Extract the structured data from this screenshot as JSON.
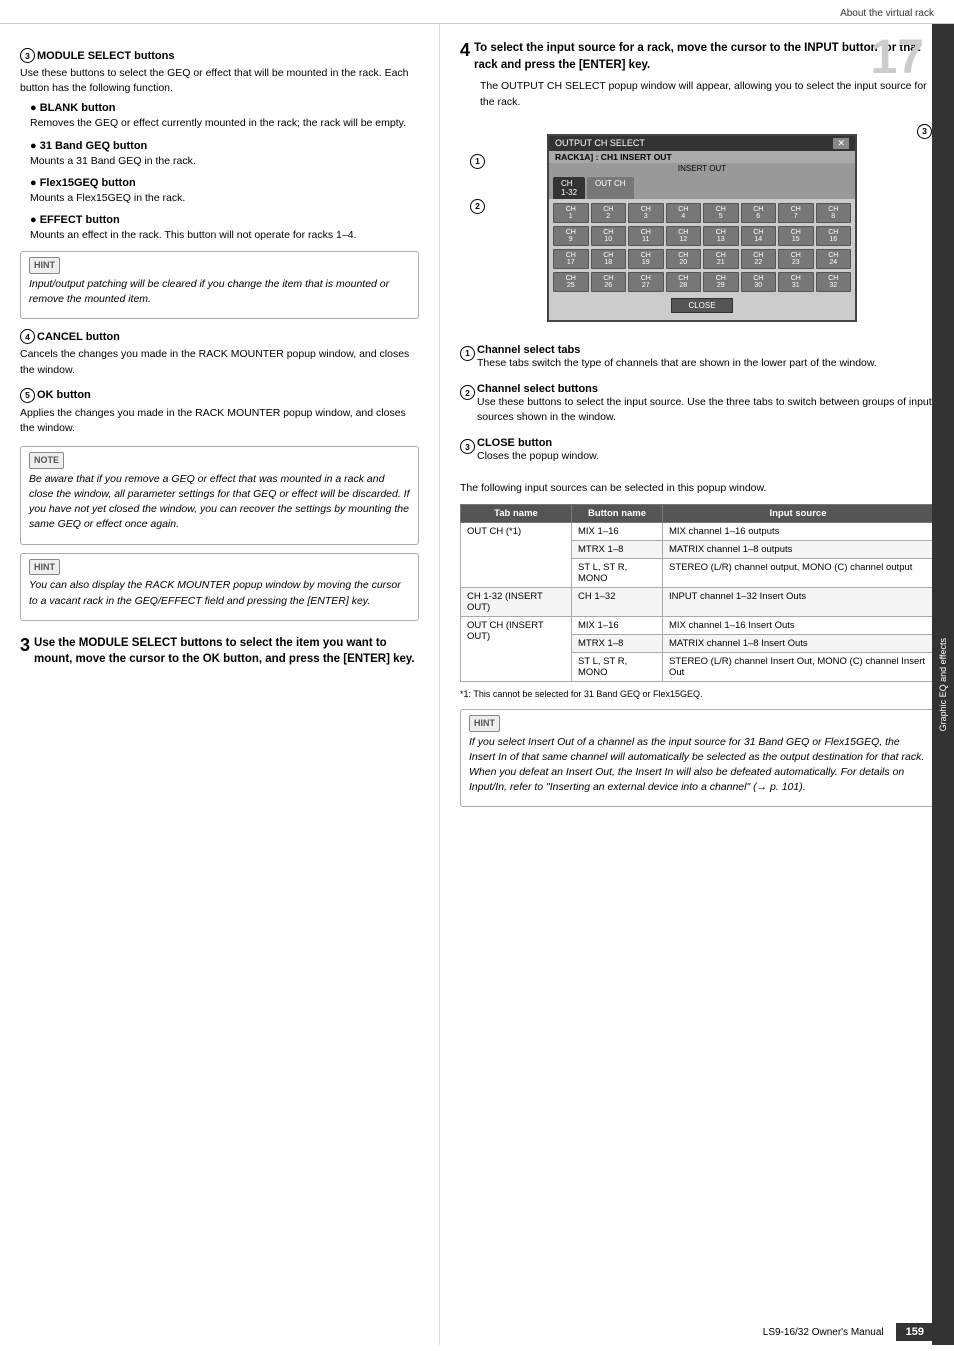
{
  "header": {
    "title": "About the virtual rack"
  },
  "footer": {
    "manual": "LS9-16/32  Owner's Manual",
    "page": "159"
  },
  "chapter": {
    "number": "17",
    "label": "Graphic EQ and effects"
  },
  "left_column": {
    "section3_circle": "3",
    "section3_title": "MODULE SELECT buttons",
    "section3_body": "Use these buttons to select the GEQ or effect that will be mounted in the rack. Each button has the following function.",
    "blank_button_title": "BLANK button",
    "blank_button_body": "Removes the GEQ or effect currently mounted in the rack; the rack will be empty.",
    "band31_button_title": "31 Band GEQ button",
    "band31_button_body": "Mounts a 31 Band GEQ in the rack.",
    "flex15_button_title": "Flex15GEQ button",
    "flex15_button_body": "Mounts a Flex15GEQ in the rack.",
    "effect_button_title": "EFFECT button",
    "effect_button_body": "Mounts an effect in the rack. This button will not operate for racks 1–4.",
    "hint1_label": "HINT",
    "hint1_text": "Input/output patching will be cleared if you change the item that is mounted or remove the mounted item.",
    "section4_circle": "4",
    "section4_title": "CANCEL button",
    "section4_body": "Cancels the changes you made in the RACK MOUNTER popup window, and closes the window.",
    "section5_circle": "5",
    "section5_title": "OK button",
    "section5_body": "Applies the changes you made in the RACK MOUNTER popup window, and closes the window.",
    "note_label": "NOTE",
    "note_text": "Be aware that if you remove a GEQ or effect that was mounted in a rack and close the window, all parameter settings for that GEQ or effect will be discarded. If you have not yet closed the window, you can recover the settings by mounting the same GEQ or effect once again.",
    "hint2_label": "HINT",
    "hint2_text": "You can also display the RACK MOUNTER popup window by moving the cursor to a vacant rack in the GEQ/EFFECT field and pressing the [ENTER] key.",
    "step3_number": "3",
    "step3_text": "Use the MODULE SELECT buttons to select the item you want to mount, move the cursor to the OK button, and press the [ENTER] key."
  },
  "right_column": {
    "step4_number": "4",
    "step4_text": "To select the input source for a rack, move the cursor to the INPUT button for that rack and press the [ENTER] key.",
    "step4_body": "The OUTPUT CH SELECT popup window will appear, allowing you to select the input source for the rack.",
    "popup": {
      "title": "OUTPUT CH SELECT",
      "subtitle": "RACK1A] : CH1  INSERT OUT",
      "subtitle2": "INSERT OUT",
      "tabs": [
        "CH 1-32",
        "OUT CH"
      ],
      "active_tab": "CH 1-32",
      "annotation1": "1",
      "annotation2": "2",
      "annotation3": "3",
      "close_label": "CLOSE",
      "rows": [
        [
          "CH 1",
          "CH 2",
          "CH 3",
          "CH 4",
          "CH 5",
          "CH 6",
          "CH 7",
          "CH 8"
        ],
        [
          "CH 9",
          "CH 10",
          "CH 11",
          "CH 12",
          "CH 13",
          "CH 14",
          "CH 15",
          "CH 16"
        ],
        [
          "CH 17",
          "CH 18",
          "CH 19",
          "CH 20",
          "CH 21",
          "CH 22",
          "CH 23",
          "CH 24"
        ],
        [
          "CH 25",
          "CH 26",
          "CH 27",
          "CH 28",
          "CH 29",
          "CH 30",
          "CH 31",
          "CH 32"
        ]
      ]
    },
    "annot1_title": "Channel select tabs",
    "annot1_body": "These tabs switch the type of channels that are shown in the lower part of the window.",
    "annot2_title": "Channel select buttons",
    "annot2_body": "Use these buttons to select the input source. Use the three tabs to switch between groups of input sources shown in the window.",
    "annot3_title": "CLOSE button",
    "annot3_body": "Closes the popup window.",
    "table_intro": "The following input sources can be selected in this popup window.",
    "table": {
      "headers": [
        "Tab name",
        "Button name",
        "Input source"
      ],
      "rows": [
        {
          "tab": "OUT CH (*1)",
          "buttons": [
            {
              "name": "MIX 1–16",
              "source": "MIX channel 1–16 outputs"
            },
            {
              "name": "MTRX 1–8",
              "source": "MATRIX channel 1–8 outputs"
            },
            {
              "name": "ST L, ST R, MONO",
              "source": "STEREO (L/R) channel output, MONO (C) channel output"
            }
          ]
        },
        {
          "tab": "CH 1-32 (INSERT OUT)",
          "buttons": [
            {
              "name": "CH 1–32",
              "source": "INPUT channel 1–32 Insert Outs"
            }
          ]
        },
        {
          "tab": "OUT CH (INSERT OUT)",
          "buttons": [
            {
              "name": "MIX 1–16",
              "source": "MIX channel 1–16 Insert Outs"
            },
            {
              "name": "MTRX 1–8",
              "source": "MATRIX channel 1–8 Insert Outs"
            },
            {
              "name": "ST L, ST R, MONO",
              "source": "STEREO (L/R) channel Insert Out, MONO (C) channel Insert Out"
            }
          ]
        }
      ]
    },
    "footnote": "*1: This cannot be selected for 31 Band GEQ or Flex15GEQ.",
    "hint3_label": "HINT",
    "hint3_text": "If you select Insert Out of a channel as the input source for 31 Band GEQ or Flex15GEQ, the Insert In of that same channel will automatically be selected as the output destination for that rack. When you defeat an Insert Out, the Insert In will also be defeated automatically. For details on Input/In, refer to \"Inserting an external device into a channel\" (→ p. 101)."
  }
}
